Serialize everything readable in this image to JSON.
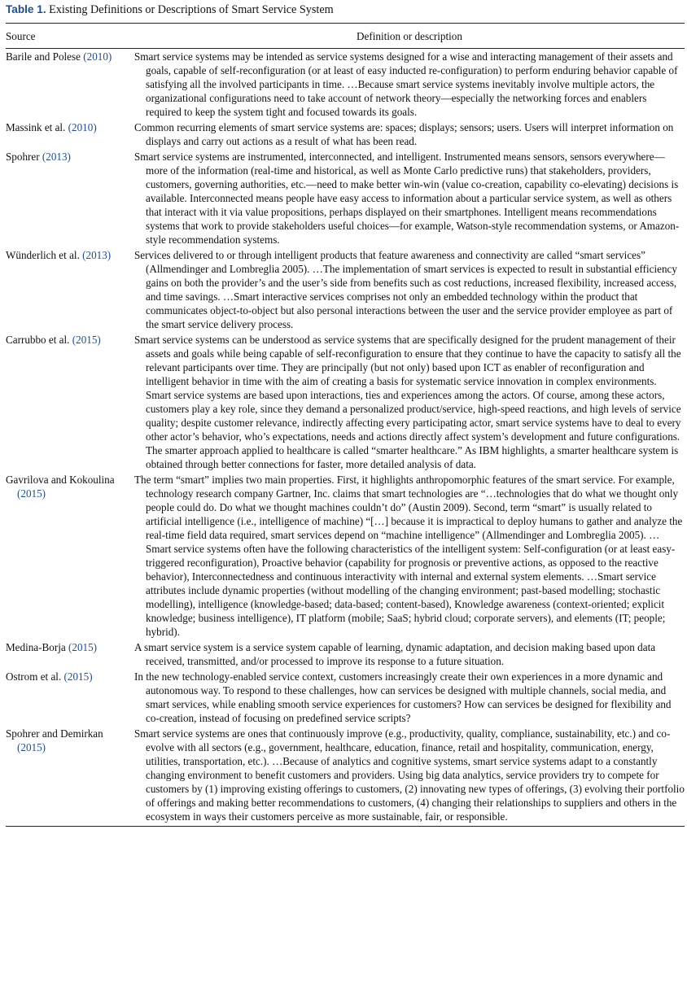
{
  "table": {
    "label": "Table 1.",
    "title": "Existing Definitions or Descriptions of Smart Service System",
    "headers": {
      "source": "Source",
      "definition": "Definition or description"
    },
    "rows": [
      {
        "source_name": "Barile and Polese ",
        "source_year": "(2010)",
        "text": "Smart service systems may be intended as service systems designed for a wise and interacting management of their assets and goals, capable of self-reconfiguration (or at least of easy inducted re-configuration) to perform enduring behavior capable of satisfying all the involved participants in time. …Because smart service systems inevitably involve multiple actors, the organizational configurations need to take account of network theory—especially the networking forces and enablers required to keep the system tight and focused towards its goals."
      },
      {
        "source_name": "Massink et al. ",
        "source_year": "(2010)",
        "text": "Common recurring elements of smart service systems are: spaces; displays; sensors; users. Users will interpret information on displays and carry out actions as a result of what has been read."
      },
      {
        "source_name": "Spohrer ",
        "source_year": "(2013)",
        "text": "Smart service systems are instrumented, interconnected, and intelligent. Instrumented means sensors, sensors everywhere—more of the information (real-time and historical, as well as Monte Carlo predictive runs) that stakeholders, providers, customers, governing authorities, etc.—need to make better win-win (value co-creation, capability co-elevating) decisions is available. Interconnected means people have easy access to information about a particular service system, as well as others that interact with it via value propositions, perhaps displayed on their smartphones. Intelligent means recommendations systems that work to provide stakeholders useful choices—for example, Watson-style recommendation systems, or Amazon-style recommendation systems."
      },
      {
        "source_name": "Wünderlich et al. ",
        "source_year": "(2013)",
        "text": "Services delivered to or through intelligent products that feature awareness and connectivity are called “smart services” (Allmendinger and Lombreglia 2005). …The implementation of smart services is expected to result in substantial efficiency gains on both the provider’s and the user’s side from benefits such as cost reductions, increased flexibility, increased access, and time savings. …Smart interactive services comprises not only an embedded technology within the product that communicates object-to-object but also personal interactions between the user and the service provider employee as part of the smart service delivery process."
      },
      {
        "source_name": "Carrubbo et al. ",
        "source_year": "(2015)",
        "text": "Smart service systems can be understood as service systems that are specifically designed for the prudent management of their assets and goals while being capable of self-reconfiguration to ensure that they continue to have the capacity to satisfy all the relevant participants over time. They are principally (but not only) based upon ICT as enabler of reconfiguration and intelligent behavior in time with the aim of creating a basis for systematic service innovation in complex environments. Smart service systems are based upon interactions, ties and experiences among the actors. Of course, among these actors, customers play a key role, since they demand a personalized product/service, high-speed reactions, and high levels of service quality; despite customer relevance, indirectly affecting every participating actor, smart service systems have to deal to every other actor’s behavior, who’s expectations, needs and actions directly affect system’s development and future configurations. The smarter approach applied to healthcare is called “smarter healthcare.” As IBM highlights, a smarter healthcare system is obtained through better connections for faster, more detailed analysis of data."
      },
      {
        "source_name": "Gavrilova and Kokoulina ",
        "source_year": "(2015)",
        "text": "The term “smart” implies two main properties. First, it highlights anthropomorphic features of the smart service. For example, technology research company Gartner, Inc. claims that smart technologies are “…technologies that do what we thought only people could do. Do what we thought machines couldn’t do” (Austin 2009). Second, term “smart” is usually related to artificial intelligence (i.e., intelligence of machine) “[…] because it is impractical to deploy humans to gather and analyze the real-time field data required, smart services depend on “machine intelligence” (Allmendinger and Lombreglia 2005). …Smart service systems often have the following characteristics of the intelligent system: Self-configuration (or at least easy-triggered reconfiguration), Proactive behavior (capability for prognosis or preventive actions, as opposed to the reactive behavior), Interconnectedness and continuous interactivity with internal and external system elements. …Smart service attributes include dynamic properties (without modelling of the changing environment; past-based modelling; stochastic modelling), intelligence (knowledge-based; data-based; content-based), Knowledge awareness (context-oriented; explicit knowledge; business intelligence), IT platform (mobile; SaaS; hybrid cloud; corporate servers), and elements (IT; people; hybrid)."
      },
      {
        "source_name": "Medina-Borja ",
        "source_year": "(2015)",
        "text": "A smart service system is a service system capable of learning, dynamic adaptation, and decision making based upon data received, transmitted, and/or processed to improve its response to a future situation."
      },
      {
        "source_name": "Ostrom et al. ",
        "source_year": "(2015)",
        "text": "In the new technology-enabled service context, customers increasingly create their own experiences in a more dynamic and autonomous way. To respond to these challenges, how can services be designed with multiple channels, social media, and smart services, while enabling smooth service experiences for customers? How can services be designed for flexibility and co-creation, instead of focusing on predefined service scripts?"
      },
      {
        "source_name": "Spohrer and Demirkan ",
        "source_year": "(2015)",
        "text": "Smart service systems are ones that continuously improve (e.g., productivity, quality, compliance, sustainability, etc.) and co-evolve with all sectors (e.g., government, healthcare, education, finance, retail and hospitality, communication, energy, utilities, transportation, etc.). …Because of analytics and cognitive systems, smart service systems adapt to a constantly changing environment to benefit customers and providers. Using big data analytics, service providers try to compete for customers by (1) improving existing offerings to customers, (2) innovating new types of offerings, (3) evolving their portfolio of offerings and making better recommendations to customers, (4) changing their relationships to suppliers and others in the ecosystem in ways their customers perceive as more sustainable, fair, or responsible."
      }
    ]
  },
  "colors": {
    "accent": "#1f4e8c",
    "text": "#111111",
    "rule": "#222222"
  }
}
